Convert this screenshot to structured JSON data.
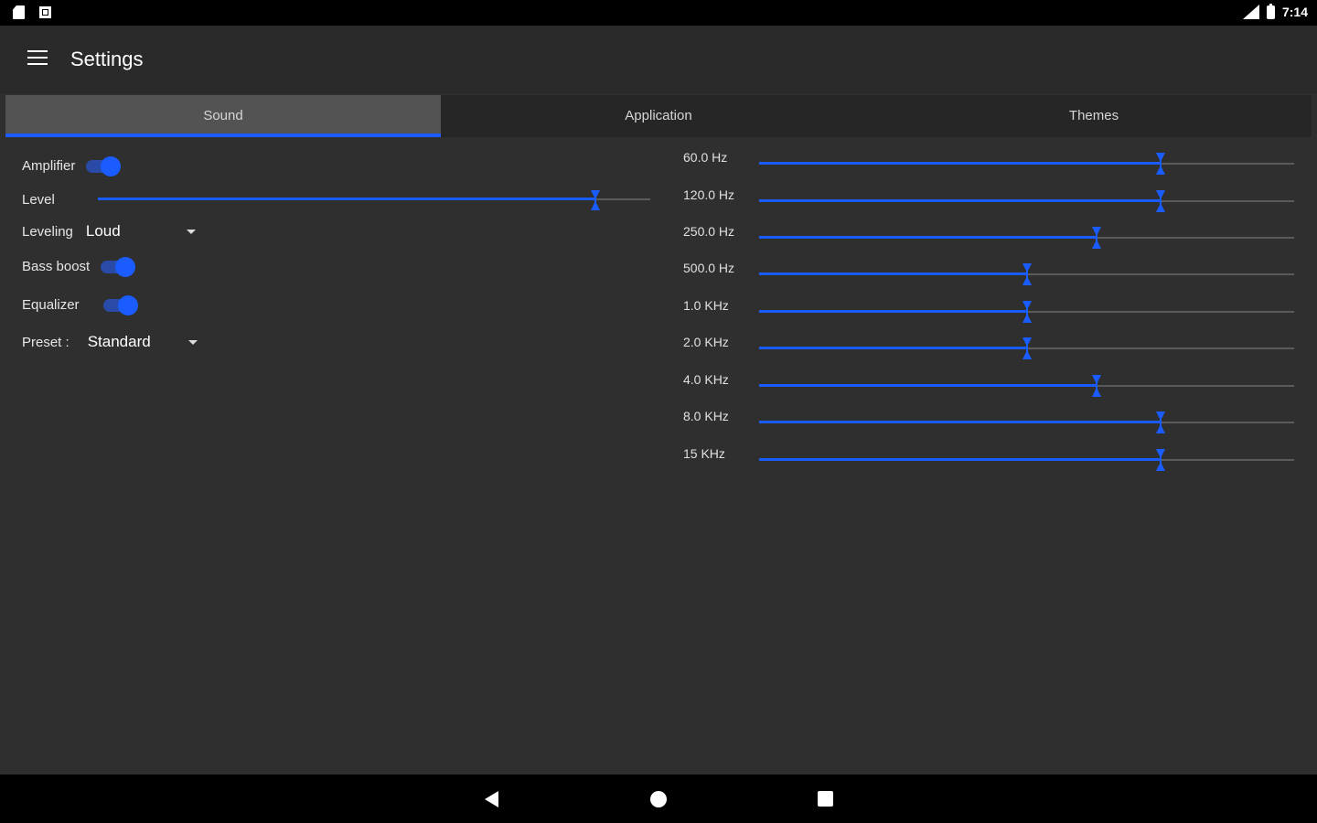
{
  "status_bar": {
    "time": "7:14",
    "icons": [
      "sd-card-icon",
      "notification-icon",
      "signal-icon",
      "battery-icon"
    ]
  },
  "app_bar": {
    "title": "Settings"
  },
  "tabs": [
    {
      "label": "Sound",
      "active": true
    },
    {
      "label": "Application",
      "active": false
    },
    {
      "label": "Themes",
      "active": false
    }
  ],
  "sound": {
    "amplifier": {
      "label": "Amplifier",
      "on": true
    },
    "level": {
      "label": "Level",
      "value_fraction": 0.9
    },
    "leveling": {
      "label": "Leveling",
      "value": "Loud"
    },
    "bass_boost": {
      "label": "Bass boost",
      "on": true
    },
    "equalizer": {
      "label": "Equalizer",
      "on": true
    },
    "preset": {
      "label": "Preset :",
      "value": "Standard"
    }
  },
  "equalizer_bands": [
    {
      "label": "60.0 Hz",
      "value_fraction": 0.75
    },
    {
      "label": "120.0 Hz",
      "value_fraction": 0.75
    },
    {
      "label": "250.0 Hz",
      "value_fraction": 0.63
    },
    {
      "label": "500.0 Hz",
      "value_fraction": 0.5
    },
    {
      "label": "1.0 KHz",
      "value_fraction": 0.5
    },
    {
      "label": "2.0 KHz",
      "value_fraction": 0.5
    },
    {
      "label": "4.0 KHz",
      "value_fraction": 0.63
    },
    {
      "label": "8.0 KHz",
      "value_fraction": 0.75
    },
    {
      "label": "15 KHz",
      "value_fraction": 0.75
    }
  ],
  "colors": {
    "accent": "#1a5cff",
    "background": "#2f2f2f",
    "appbar": "#2a2a2a"
  },
  "nav_bar": {
    "icons": [
      "back-icon",
      "home-icon",
      "recents-icon"
    ]
  }
}
